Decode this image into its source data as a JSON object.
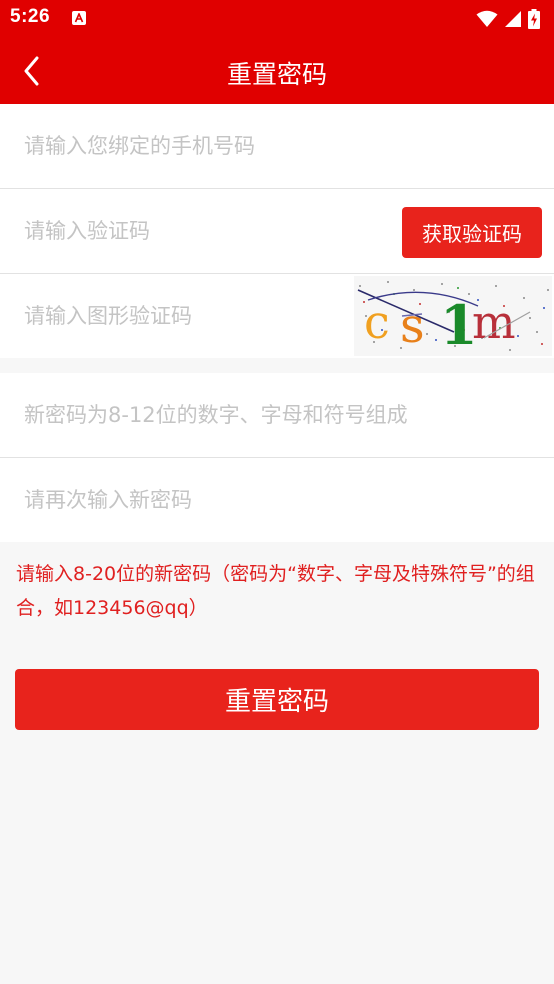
{
  "status_bar": {
    "time": "5:26",
    "icons": [
      "notification-a-icon",
      "wifi-icon",
      "signal-icon",
      "battery-charging-icon"
    ]
  },
  "app_bar": {
    "title": "重置密码",
    "back_icon": "chevron-left-icon"
  },
  "form": {
    "phone": {
      "placeholder": "请输入您绑定的手机号码",
      "value": ""
    },
    "sms_code": {
      "placeholder": "请输入验证码",
      "value": "",
      "button_label": "获取验证码"
    },
    "captcha": {
      "placeholder": "请输入图形验证码",
      "value": "",
      "image_text": "cs1m"
    },
    "new_password": {
      "placeholder": "新密码为8-12位的数字、字母和符号组成",
      "value": ""
    },
    "confirm_password": {
      "placeholder": "请再次输入新密码",
      "value": ""
    }
  },
  "hint": "请输入8-20位的新密码（密码为“数字、字母及特殊符号”的组合，如123456@qq）",
  "submit_label": "重置密码",
  "colors": {
    "primary": "#e00000",
    "button": "#e8231c",
    "hint": "#e02020",
    "placeholder": "#c4c4c4",
    "background": "#f7f7f7"
  }
}
